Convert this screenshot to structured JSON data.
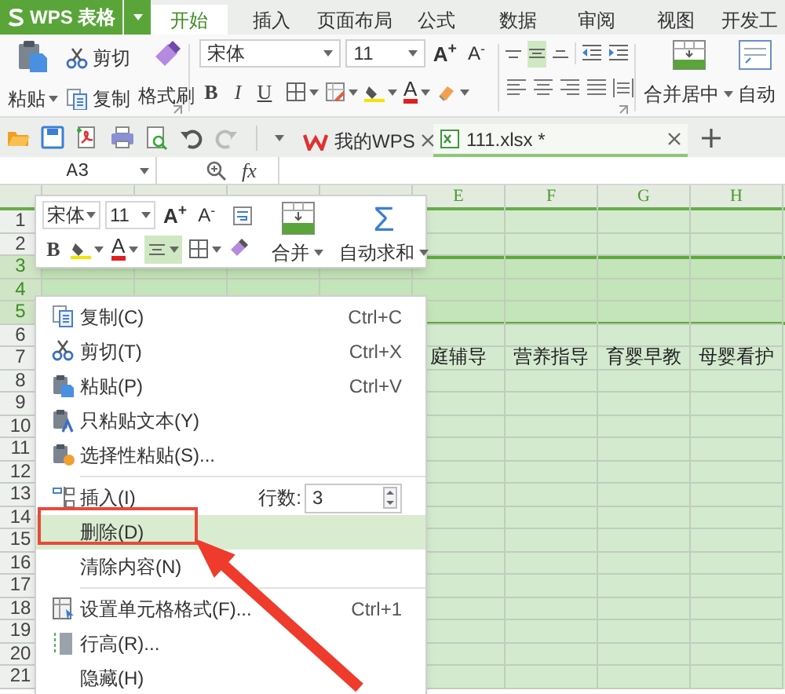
{
  "app_button": {
    "label": "WPS 表格"
  },
  "ribbon_tabs": [
    {
      "label": "开始",
      "selected": true
    },
    {
      "label": "插入",
      "selected": false
    },
    {
      "label": "页面布局",
      "selected": false
    },
    {
      "label": "公式",
      "selected": false
    },
    {
      "label": "数据",
      "selected": false
    },
    {
      "label": "审阅",
      "selected": false
    },
    {
      "label": "视图",
      "selected": false
    },
    {
      "label": "开发工",
      "selected": false
    }
  ],
  "ribbon": {
    "paste": "粘贴",
    "cut": "剪切",
    "copy": "复制",
    "format_painter": "格式刷",
    "font": "宋体",
    "font_size": "11",
    "grow_font": "A$^{+}$",
    "shrink_font": "A$^{-}$",
    "bold": "B",
    "italic": "I",
    "underline": "U",
    "font_color": "A",
    "vertical_align": [
      {
        "kind": "top",
        "selected": false
      },
      {
        "kind": "middle",
        "selected": true
      },
      {
        "kind": "bottom",
        "selected": false
      }
    ],
    "merge": "合并居中",
    "autosum": "自动"
  },
  "doc_tabs": [
    {
      "label": "我的WPS",
      "selected": false
    },
    {
      "label": "111.xlsx *",
      "selected": true
    }
  ],
  "formula_bar": {
    "name_box": "A3",
    "fx": "fx"
  },
  "sheet": {
    "visible_columns": [
      "E",
      "F",
      "G",
      "H"
    ],
    "rows": [
      {
        "number": "1",
        "selected": false
      },
      {
        "number": "2",
        "selected": false
      },
      {
        "number": "3",
        "selected": true
      },
      {
        "number": "4",
        "selected": true
      },
      {
        "number": "5",
        "selected": true
      },
      {
        "number": "6",
        "selected": false
      },
      {
        "number": "7",
        "selected": false,
        "cells": [
          "庭辅导",
          "营养指导",
          "育婴早教",
          "母婴看护"
        ]
      },
      {
        "number": "8",
        "selected": false
      },
      {
        "number": "9",
        "selected": false
      },
      {
        "number": "10",
        "selected": false
      },
      {
        "number": "11",
        "selected": false
      },
      {
        "number": "12",
        "selected": false
      },
      {
        "number": "13",
        "selected": false
      },
      {
        "number": "14",
        "selected": false
      },
      {
        "number": "15",
        "selected": false
      },
      {
        "number": "16",
        "selected": false
      },
      {
        "number": "17",
        "selected": false
      },
      {
        "number": "18",
        "selected": false
      },
      {
        "number": "19",
        "selected": false
      },
      {
        "number": "20",
        "selected": false
      },
      {
        "number": "21",
        "selected": false
      }
    ]
  },
  "mini_toolbar": {
    "font": "宋体",
    "font_size": "11",
    "grow_font": "A$^{+}$",
    "shrink_font": "A$^{-}$",
    "bold": "B",
    "font_color": "A",
    "center_align": {
      "selected": true
    },
    "merge": "合并",
    "autosum_symbol": "Σ",
    "autosum": "自动求和"
  },
  "context_menu": {
    "items": [
      {
        "kind": "copy",
        "label": "复制(C)",
        "shortcut": "Ctrl+C",
        "selected": false
      },
      {
        "kind": "cut",
        "label": "剪切(T)",
        "shortcut": "Ctrl+X",
        "selected": false
      },
      {
        "kind": "paste",
        "label": "粘贴(P)",
        "shortcut": "Ctrl+V",
        "selected": false
      },
      {
        "kind": "paste-text",
        "label": "只粘贴文本(Y)",
        "selected": false
      },
      {
        "kind": "paste-special",
        "label": "选择性粘贴(S)...",
        "selected": false
      },
      {
        "kind": "separator"
      },
      {
        "kind": "insert",
        "label": "插入(I)",
        "count_label": "行数:",
        "count": "3",
        "selected": false
      },
      {
        "kind": "delete",
        "label": "删除(D)",
        "selected": true
      },
      {
        "kind": "clear",
        "label": "清除内容(N)",
        "selected": false
      },
      {
        "kind": "separator"
      },
      {
        "kind": "format",
        "label": "设置单元格格式(F)...",
        "shortcut": "Ctrl+1",
        "selected": false
      },
      {
        "kind": "row-height",
        "label": "行高(R)...",
        "selected": false
      },
      {
        "kind": "hide",
        "label": "隐藏(H)",
        "selected": false
      }
    ]
  }
}
